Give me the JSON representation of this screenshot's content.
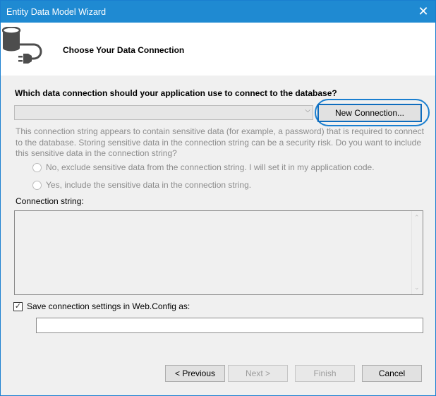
{
  "window": {
    "title": "Entity Data Model Wizard",
    "close_glyph": "✕"
  },
  "header": {
    "title": "Choose Your Data Connection",
    "icon": "database-plug-icon"
  },
  "connection": {
    "question": "Which data connection should your application use to connect to the database?",
    "selected_value": "",
    "dropdown_arrow": "⌵",
    "new_connection_label": "New Connection..."
  },
  "sensitive": {
    "message": "This connection string appears to contain sensitive data (for example, a password) that is required to connect to the database. Storing sensitive data in the connection string can be a security risk. Do you want to include this sensitive data in the connection string?",
    "options": [
      {
        "label": "No, exclude sensitive data from the connection string. I will set it in my application code.",
        "selected": false,
        "enabled": false
      },
      {
        "label": "Yes, include the sensitive data in the connection string.",
        "selected": false,
        "enabled": false
      }
    ]
  },
  "connection_string": {
    "label": "Connection string:",
    "value": "",
    "scroll_up": "⌃",
    "scroll_down": "⌄"
  },
  "save": {
    "label": "Save connection settings in Web.Config as:",
    "checked": true,
    "check_glyph": "✓",
    "value": ""
  },
  "buttons": {
    "previous": "< Previous",
    "next": "Next >",
    "finish": "Finish",
    "cancel": "Cancel"
  }
}
